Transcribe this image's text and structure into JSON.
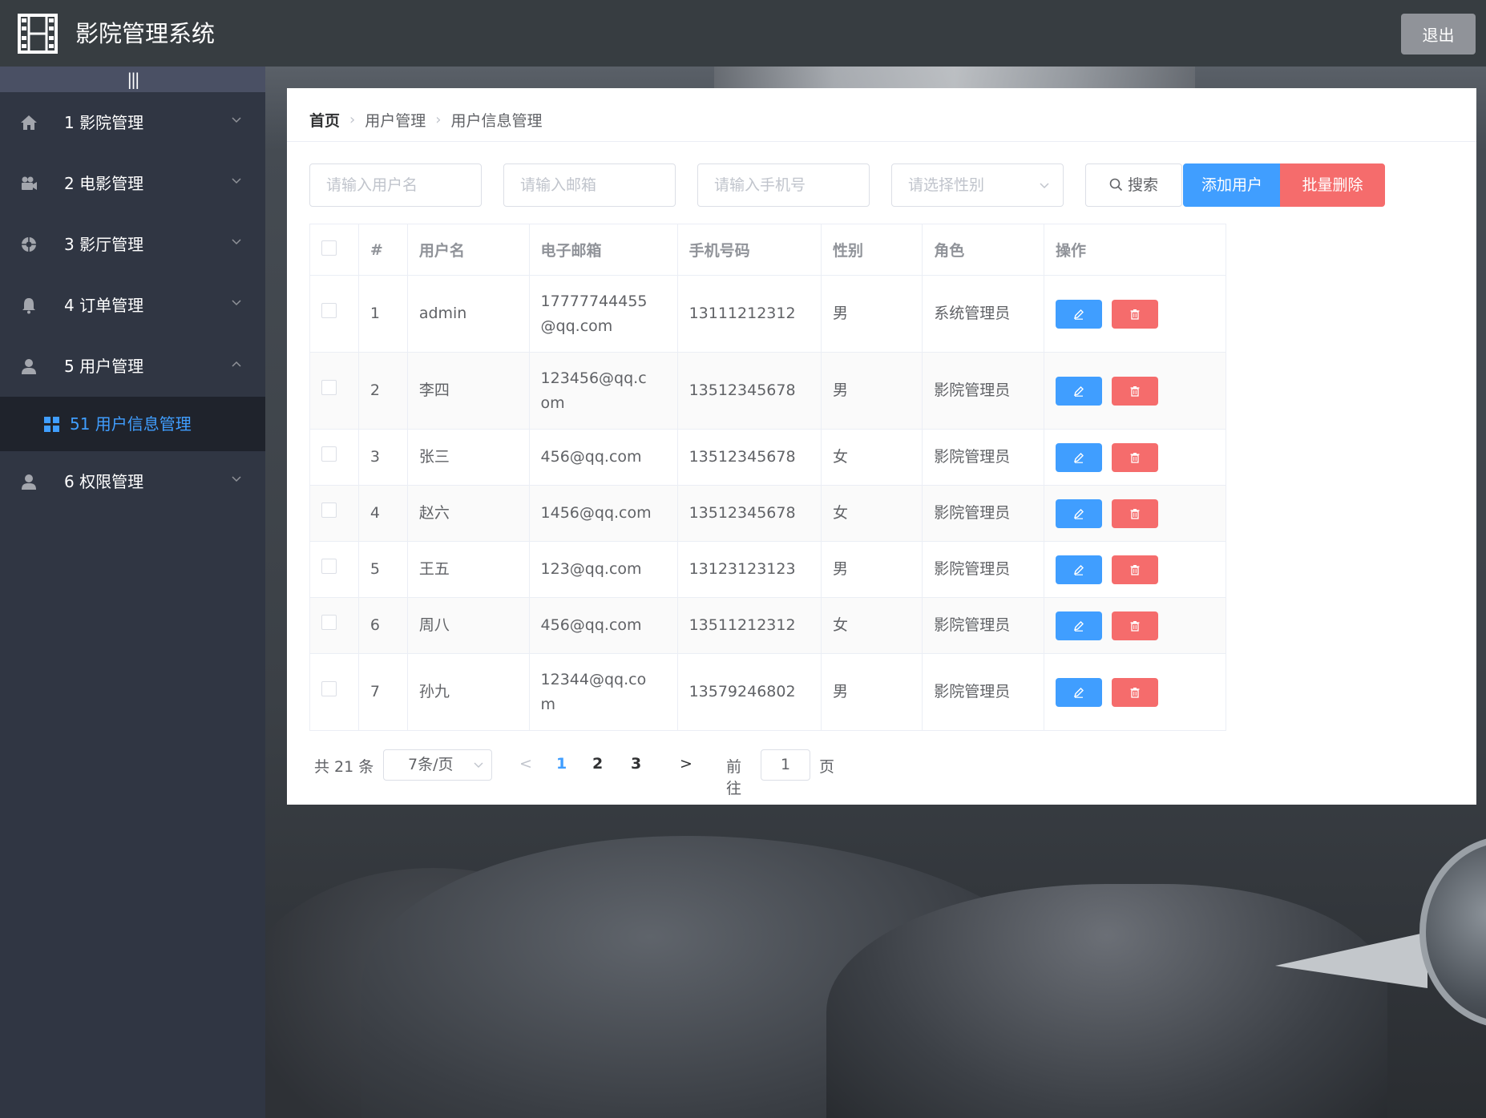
{
  "header": {
    "title": "影院管理系统",
    "logout_label": "退出"
  },
  "sidebar": {
    "collapse_label": "|||",
    "items": [
      {
        "label": "1 影院管理",
        "icon": "home-icon",
        "expanded": false
      },
      {
        "label": "2 电影管理",
        "icon": "camera-icon",
        "expanded": false
      },
      {
        "label": "3 影厅管理",
        "icon": "aperture-icon",
        "expanded": false
      },
      {
        "label": "4 订单管理",
        "icon": "bell-icon",
        "expanded": false
      },
      {
        "label": "5 用户管理",
        "icon": "user-icon",
        "expanded": true
      },
      {
        "label": "6 权限管理",
        "icon": "user-icon",
        "expanded": false
      }
    ],
    "submenu": {
      "label": "51 用户信息管理",
      "icon": "grid-icon"
    }
  },
  "breadcrumb": [
    "首页",
    "用户管理",
    "用户信息管理"
  ],
  "search": {
    "username_placeholder": "请输入用户名",
    "email_placeholder": "请输入邮箱",
    "phone_placeholder": "请输入手机号",
    "gender_placeholder": "请选择性别",
    "search_label": "搜索",
    "add_label": "添加用户",
    "batch_delete_label": "批量删除"
  },
  "table": {
    "headers": [
      "#",
      "用户名",
      "电子邮箱",
      "手机号码",
      "性别",
      "角色",
      "操作"
    ],
    "rows": [
      {
        "id": "1",
        "username": "admin",
        "email": "17777744455@qq.com",
        "email_lines": [
          "17777744455",
          "@qq.com"
        ],
        "phone": "13111212312",
        "gender": "男",
        "role": "系统管理员"
      },
      {
        "id": "2",
        "username": "李四",
        "email": "123456@qq.com",
        "email_lines": [
          "123456@qq.c",
          "om"
        ],
        "phone": "13512345678",
        "gender": "男",
        "role": "影院管理员"
      },
      {
        "id": "3",
        "username": "张三",
        "email": "456@qq.com",
        "email_lines": [
          "456@qq.com"
        ],
        "phone": "13512345678",
        "gender": "女",
        "role": "影院管理员"
      },
      {
        "id": "4",
        "username": "赵六",
        "email": "1456@qq.com",
        "email_lines": [
          "1456@qq.com"
        ],
        "phone": "13512345678",
        "gender": "女",
        "role": "影院管理员"
      },
      {
        "id": "5",
        "username": "王五",
        "email": "123@qq.com",
        "email_lines": [
          "123@qq.com"
        ],
        "phone": "13123123123",
        "gender": "男",
        "role": "影院管理员"
      },
      {
        "id": "6",
        "username": "周八",
        "email": "456@qq.com",
        "email_lines": [
          "456@qq.com"
        ],
        "phone": "13511212312",
        "gender": "女",
        "role": "影院管理员"
      },
      {
        "id": "7",
        "username": "孙九",
        "email": "12344@qq.com",
        "email_lines": [
          "12344@qq.co",
          "m"
        ],
        "phone": "13579246802",
        "gender": "男",
        "role": "影院管理员"
      }
    ]
  },
  "pagination": {
    "total_label": "共 21 条",
    "page_size_label": "7条/页",
    "prev": "<",
    "pages": [
      "1",
      "2",
      "3"
    ],
    "current_page": "1",
    "next": ">",
    "goto_label": "前往",
    "goto_value": "1",
    "page_suffix": "页"
  },
  "colors": {
    "primary": "#409eff",
    "danger": "#f56c6c",
    "header_bg": "#373d41",
    "sidebar_bg": "#303643"
  }
}
